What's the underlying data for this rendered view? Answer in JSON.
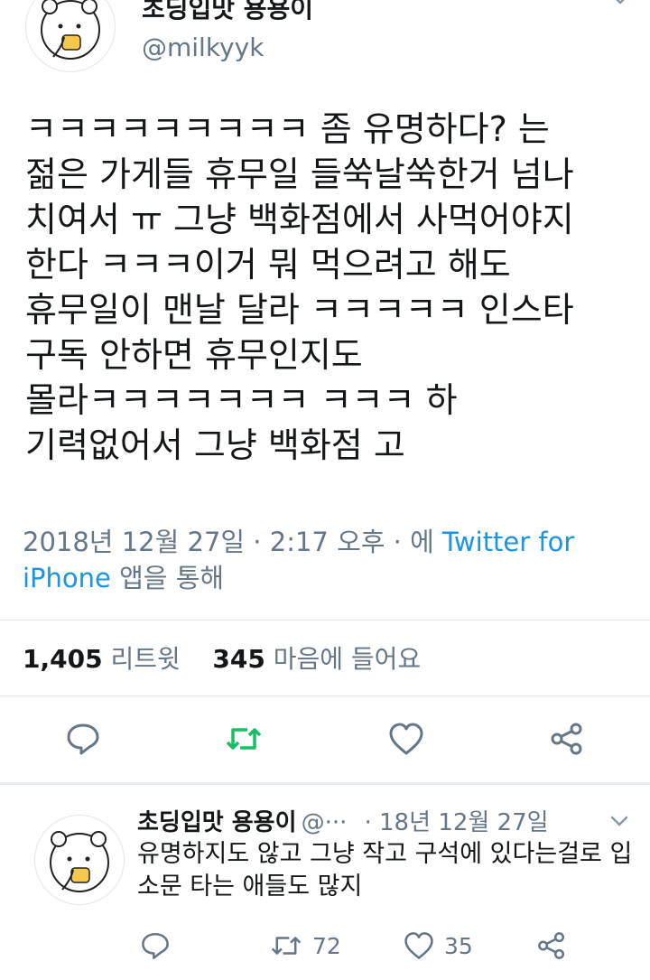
{
  "tweet": {
    "author_name": "초딩입맛 용용이",
    "author_handle": "@milkyyk",
    "text": "ㅋㅋㅋㅋㅋㅋㅋㅋㅋ 좀 유명하다? 는\n젊은 가게들 휴무일 들쑥날쑥한거 넘나\n치여서 ㅠ 그냥 백화점에서 사먹어야지\n한다 ㅋㅋㅋ이거 뭐 먹으려고 해도\n휴무일이 맨날 달라 ㅋㅋㅋㅋㅋ 인스타\n구독 안하면 휴무인지도\n몰라ㅋㅋㅋㅋㅋㅋㅋ ㅋㅋㅋ 하\n기력없어서 그냥 백화점 고",
    "timestamp": "2018년 12월 27일 · 2:17 오후 · 에",
    "source": "Twitter for iPhone",
    "source_suffix": "앱을 통해",
    "retweet_count": "1,405",
    "retweet_label": "리트윗",
    "like_count": "345",
    "like_label": "마음에 들어요"
  },
  "reply": {
    "author_name": "초딩입맛 용용이",
    "author_handle": "@···",
    "date": "· 18년 12월 27일",
    "text": "유명하지도 않고 그냥 작고 구석에 있다는걸로 입소문 타는 애들도 많지",
    "retweet_count": "72",
    "like_count": "35"
  },
  "icons": {
    "reply": "reply-icon",
    "retweet": "retweet-icon",
    "like": "heart-icon",
    "share": "share-icon",
    "more": "chevron-down-icon"
  },
  "colors": {
    "link": "#1b95e0",
    "retweet_active": "#17bf63",
    "muted": "#657786"
  }
}
